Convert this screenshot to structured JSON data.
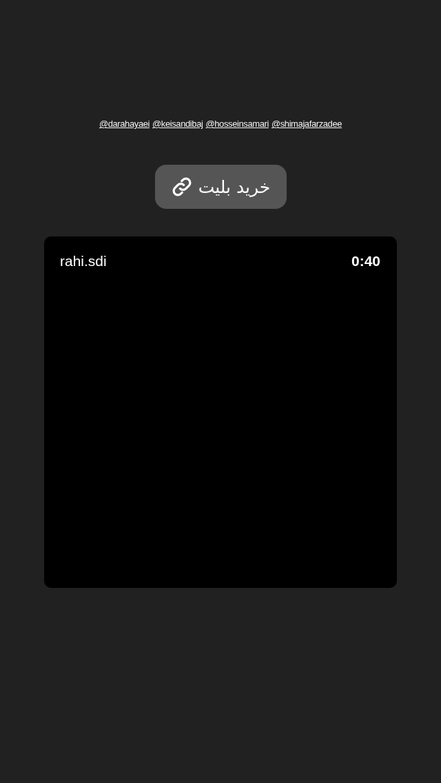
{
  "mentions": [
    "@darahayaei",
    "@keisandibaj",
    "@hosseinsamari",
    "@shimajafarzadee"
  ],
  "link_sticker": {
    "label": "خرید بلیت"
  },
  "video": {
    "username": "rahi.sdi",
    "time": "0:40"
  }
}
